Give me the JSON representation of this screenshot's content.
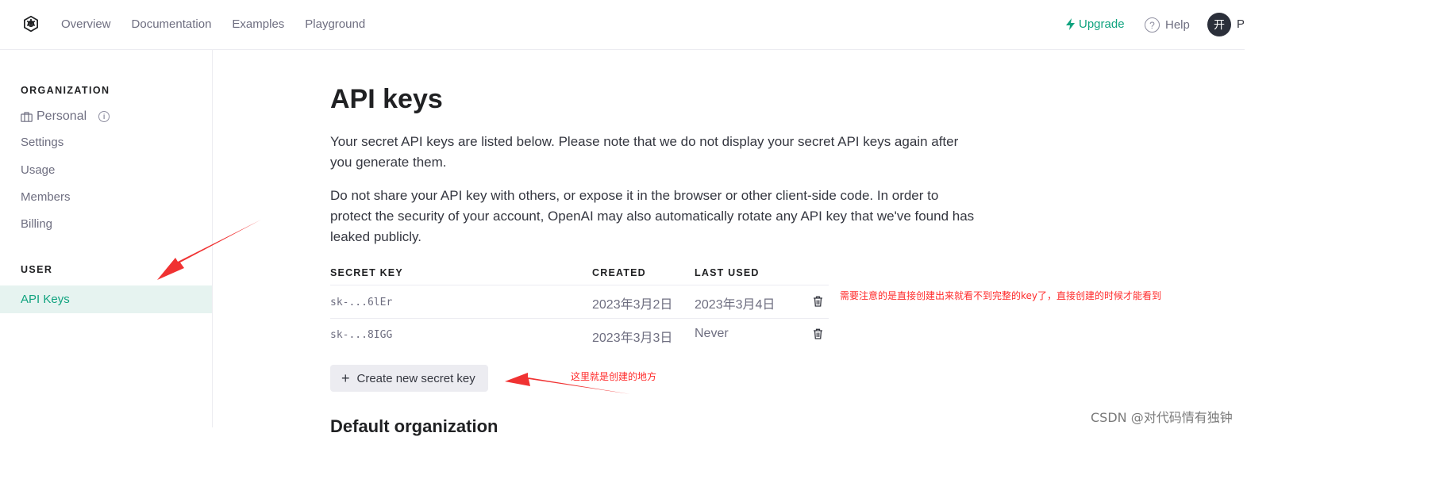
{
  "nav": {
    "links": [
      "Overview",
      "Documentation",
      "Examples",
      "Playground"
    ],
    "upgrade_label": "Upgrade",
    "help_label": "Help",
    "avatar_initial": "开",
    "profile_initial": "P"
  },
  "sidebar": {
    "org_heading": "ORGANIZATION",
    "org_name": "Personal",
    "items": [
      "Settings",
      "Usage",
      "Members",
      "Billing"
    ],
    "user_heading": "USER",
    "active_item": "API Keys"
  },
  "main": {
    "title": "API keys",
    "para1": "Your secret API keys are listed below. Please note that we do not display your secret API keys again after you generate them.",
    "para2": "Do not share your API key with others, or expose it in the browser or other client-side code. In order to protect the security of your account, OpenAI may also automatically rotate any API key that we've found has leaked publicly.",
    "table": {
      "headers": [
        "SECRET KEY",
        "CREATED",
        "LAST USED"
      ],
      "rows": [
        {
          "key": "sk-...6lEr",
          "created": "2023年3月2日",
          "last_used": "2023年3月4日"
        },
        {
          "key": "sk-...8IGG",
          "created": "2023年3月3日",
          "last_used": "Never"
        }
      ]
    },
    "create_button": "Create new secret key",
    "section_title": "Default organization"
  },
  "annotations": {
    "note_keys": "需要注意的是直接创建出来就看不到完整的key了，直接创建的时候才能看到",
    "note_create": "这里就是创建的地方"
  },
  "watermark": "CSDN @对代码情有独钟",
  "colors": {
    "accent": "#10a37f",
    "active_bg": "#e6f3f0",
    "annotation_red": "#ff2a2a"
  }
}
